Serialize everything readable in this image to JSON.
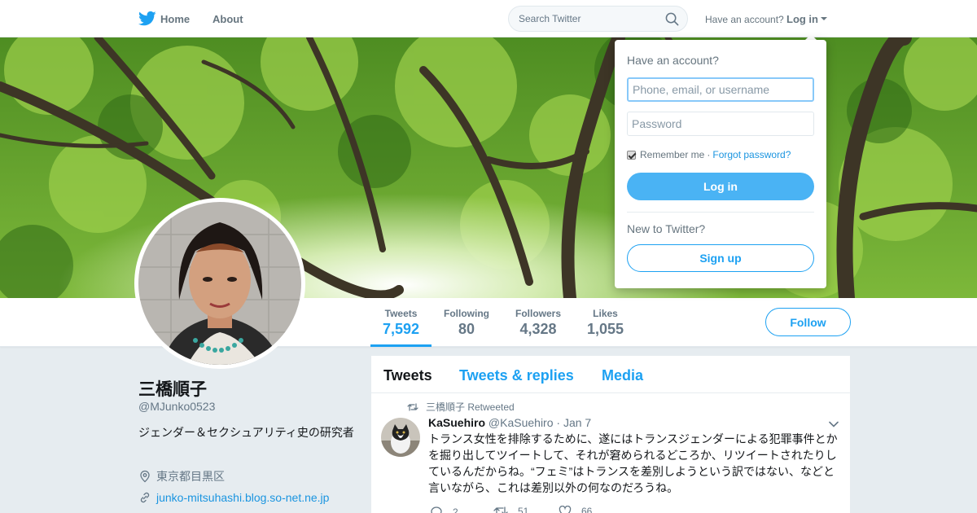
{
  "nav": {
    "home_label": "Home",
    "about_label": "About",
    "search_placeholder": "Search Twitter",
    "have_account_label": "Have an account?",
    "login_label": "Log in"
  },
  "profile": {
    "name": "三橋順子",
    "handle": "@MJunko0523",
    "bio": "ジェンダー＆セクシュアリティ史の研究者",
    "location": "東京都目黒区",
    "url": "junko-mitsuhashi.blog.so-net.ne.jp"
  },
  "stats": [
    {
      "label": "Tweets",
      "value": "7,592"
    },
    {
      "label": "Following",
      "value": "80"
    },
    {
      "label": "Followers",
      "value": "4,328"
    },
    {
      "label": "Likes",
      "value": "1,055"
    }
  ],
  "follow_label": "Follow",
  "timeline": {
    "tabs": [
      "Tweets",
      "Tweets & replies",
      "Media"
    ],
    "tweet": {
      "retweet_context": "三橋順子 Retweeted",
      "author_name": "KaSuehiro",
      "author_handle": "@KaSuehiro",
      "separator": "·",
      "date": "Jan 7",
      "text": "トランス女性を排除するために、遂にはトランスジェンダーによる犯罪事件とかを掘り出してツイートして、それが窘められるどころか、リツイートされたりしているんだからね。“フェミ”はトランスを差別しようという訳ではない、などと言いながら、これは差別以外の何なのだろうね。",
      "replies": "2",
      "retweets": "51",
      "likes": "66"
    }
  },
  "login_dropdown": {
    "title": "Have an account?",
    "username_placeholder": "Phone, email, or username",
    "password_placeholder": "Password",
    "remember_label": "Remember me",
    "separator": "·",
    "forgot_label": "Forgot password?",
    "login_button": "Log in",
    "new_label": "New to Twitter?",
    "signup_button": "Sign up"
  },
  "colors": {
    "accent": "#1da1f2",
    "link": "#1b95e0",
    "login_button": "#4ab3f4",
    "background": "#e6ecf0"
  },
  "icons": [
    "twitter-bird-icon",
    "search-icon",
    "caret-down-icon",
    "location-icon",
    "link-icon",
    "retweet-icon",
    "reply-icon",
    "like-icon",
    "chevron-down-icon"
  ]
}
